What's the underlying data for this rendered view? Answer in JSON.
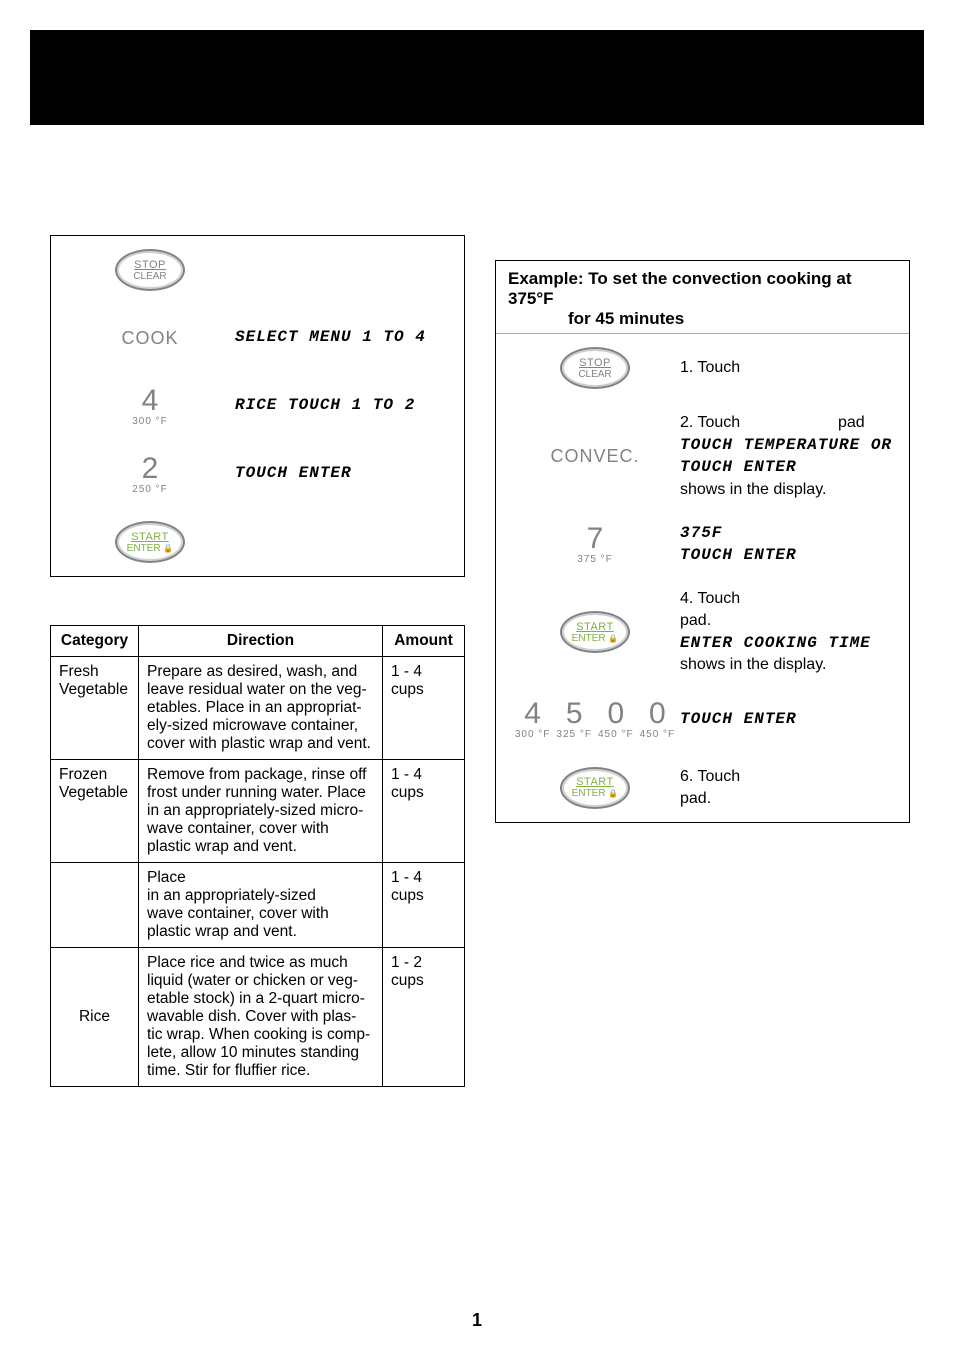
{
  "left_example": {
    "rows": [
      {
        "icon": "pad-stop",
        "text": ""
      },
      {
        "icon": "word",
        "word": "COOK",
        "digital": "SELECT MENU 1 TO 4"
      },
      {
        "icon": "num",
        "num": "4",
        "sub": "300 °F",
        "digital": "RICE TOUCH 1 TO 2"
      },
      {
        "icon": "num",
        "num": "2",
        "sub": "250 °F",
        "digital": "TOUCH ENTER"
      },
      {
        "icon": "pad-start",
        "text": ""
      }
    ]
  },
  "right_example": {
    "header_l1": "Example: To set the convection cooking at 375°F",
    "header_l2": "for 45 minutes",
    "rows": [
      {
        "icon": "pad-stop",
        "text_plain": "1. Touch"
      },
      {
        "icon": "word",
        "word": "CONVEC.",
        "text_plain_pre": "2. Touch",
        "text_plain_post": "pad",
        "digital_l1": "TOUCH TEMPERATURE OR",
        "digital_l2": "TOUCH ENTER",
        "tail": "shows in the display."
      },
      {
        "icon": "num",
        "num": "7",
        "sub": "375 °F",
        "digital_l1": "375F",
        "digital_l2": "TOUCH ENTER"
      },
      {
        "icon": "pad-start",
        "text_plain_pre": "4. Touch",
        "text_plain_post": "pad.",
        "digital_l1": "ENTER COOKING TIME",
        "tail": "shows in the display."
      },
      {
        "icon": "numseq",
        "digital_l1": "TOUCH ENTER"
      },
      {
        "icon": "pad-start",
        "text_plain_pre": "6. Touch",
        "text_plain_post": "pad."
      }
    ],
    "numseq": [
      {
        "n": "4",
        "s": "300 °F"
      },
      {
        "n": "5",
        "s": "325 °F"
      },
      {
        "n": "0",
        "s": "450 °F"
      },
      {
        "n": "0",
        "s": "450 °F"
      }
    ]
  },
  "pad_labels": {
    "stop_t1": "STOP",
    "stop_t2": "CLEAR",
    "start_t1": "START",
    "start_t2": "ENTER",
    "start_lock": "🔒"
  },
  "table": {
    "headers": {
      "cat": "Category",
      "dir": "Direction",
      "amt": "Amount"
    },
    "rows": [
      {
        "cat": "Fresh Vegetable",
        "dir": "Prepare as desired, wash, and leave residual water on the veg- etables. Place in an appropriat- ely-sized microwave container, cover with plastic wrap and vent.",
        "amt": "1 - 4 cups"
      },
      {
        "cat": "Frozen Vegetable",
        "dir": "Remove from package, rinse off frost under running water. Place in an appropriately-sized micro- wave container, cover with plastic wrap and vent.",
        "amt": "1 - 4 cups"
      },
      {
        "cat": "",
        "dir": "Place\n        in an appropriately-sized\n        wave container, cover with plastic wrap and vent.",
        "amt": "1 - 4 cups"
      },
      {
        "cat": "Rice",
        "dir": "Place rice and twice as much liquid (water or chicken or veg- etable stock) in a 2-quart micro- wavable dish. Cover with plas- tic wrap. When cooking is comp- lete, allow 10 minutes standing time. Stir for fluffier rice.",
        "amt": "1 - 2 cups"
      }
    ]
  },
  "page_number": "1"
}
